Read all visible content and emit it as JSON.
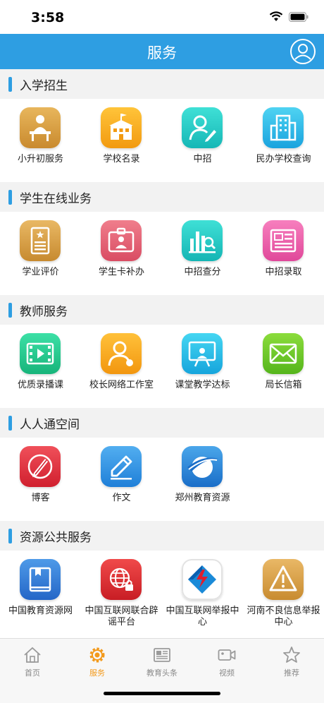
{
  "status": {
    "time": "3:58"
  },
  "header": {
    "title": "服务"
  },
  "sections": [
    {
      "title": "入学招生",
      "items": [
        "小升初服务",
        "学校名录",
        "中招",
        "民办学校查询"
      ]
    },
    {
      "title": "学生在线业务",
      "items": [
        "学业评价",
        "学生卡补办",
        "中招查分",
        "中招录取"
      ]
    },
    {
      "title": "教师服务",
      "items": [
        "优质录播课",
        "校长网络工作室",
        "课堂教学达标",
        "局长信箱"
      ]
    },
    {
      "title": "人人通空间",
      "items": [
        "博客",
        "作文",
        "郑州教育资源"
      ]
    },
    {
      "title": "资源公共服务",
      "items": [
        "中国教育资源网",
        "中国互联网联合辟谣平台",
        "中国互联网举报中心",
        "河南不良信息举报中心"
      ]
    }
  ],
  "tabs": [
    {
      "label": "首页",
      "icon": "home-icon"
    },
    {
      "label": "服务",
      "icon": "gear-icon",
      "active": true
    },
    {
      "label": "教育头条",
      "icon": "newspaper-icon"
    },
    {
      "label": "视频",
      "icon": "video-icon"
    },
    {
      "label": "推荐",
      "icon": "star-icon"
    }
  ],
  "colors": {
    "accent": "#2e9ee2",
    "active_tab": "#f39a1c"
  }
}
